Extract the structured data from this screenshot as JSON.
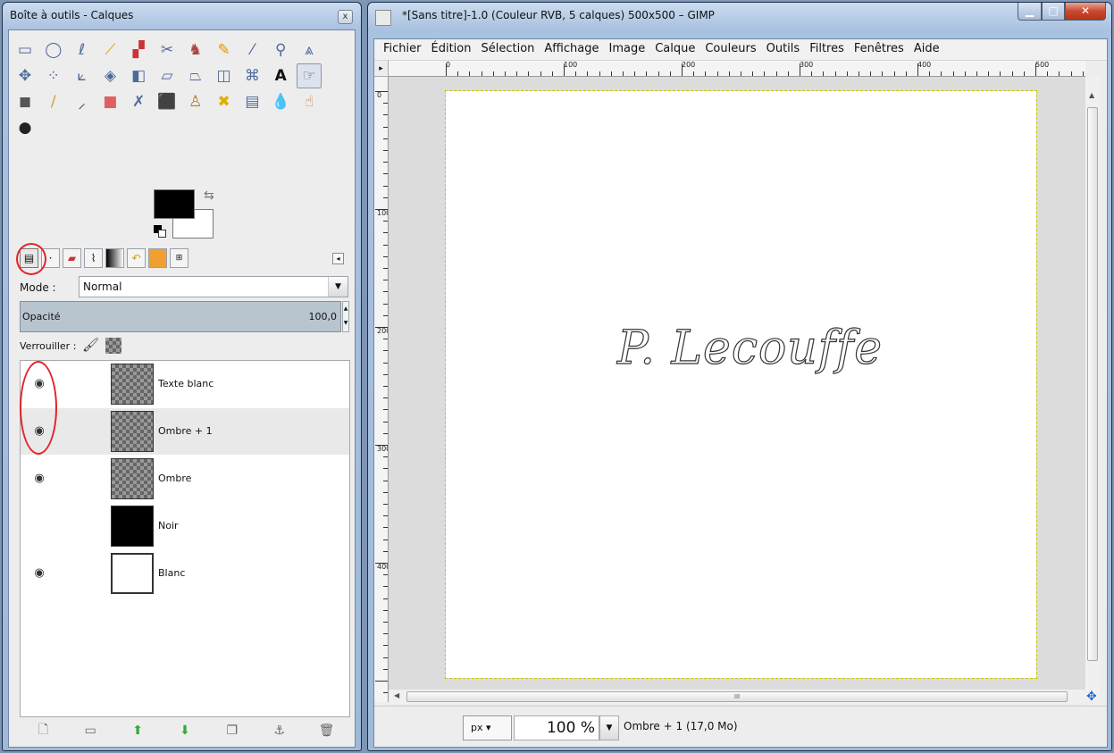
{
  "toolbox": {
    "title": "Boîte à outils - Calques",
    "close": "x",
    "tools_row1": [
      "rect-select",
      "ellipse-select",
      "free-select",
      "fuzzy-select",
      "color-select",
      "scissors-select",
      "foreground-select",
      "paths",
      "color-picker",
      "zoom",
      "measure"
    ],
    "tools_row2": [
      "move",
      "align",
      "crop",
      "rotate",
      "scale",
      "shear",
      "perspective",
      "flip",
      "cage",
      "text",
      "unified-transform"
    ],
    "tools_row3": [
      "blend",
      "pencil",
      "paintbrush",
      "eraser",
      "airbrush",
      "ink",
      "clone",
      "heal",
      "perspective-clone",
      "blur",
      "smudge"
    ],
    "tools_row4": [
      "dodge-burn"
    ],
    "fg_color": "#000000",
    "bg_color": "#ffffff",
    "mode_label": "Mode :",
    "mode_value": "Normal",
    "opacity_label": "Opacité",
    "opacity_value": "100,0",
    "lock_label": "Verrouiller :",
    "layers": [
      {
        "name": "Texte blanc",
        "visible": true,
        "thumb": "checker"
      },
      {
        "name": "Ombre + 1",
        "visible": true,
        "thumb": "checker"
      },
      {
        "name": "Ombre",
        "visible": true,
        "thumb": "checker"
      },
      {
        "name": "Noir",
        "visible": false,
        "thumb": "black"
      },
      {
        "name": "Blanc",
        "visible": true,
        "thumb": "white"
      }
    ],
    "highlight_color": "#e2242a"
  },
  "image_window": {
    "title": "*[Sans titre]-1.0 (Couleur RVB, 5 calques) 500x500 – GIMP",
    "menu": [
      "Fichier",
      "Édition",
      "Sélection",
      "Affichage",
      "Image",
      "Calque",
      "Couleurs",
      "Outils",
      "Filtres",
      "Fenêtres",
      "Aide"
    ],
    "ruler_h": [
      "0",
      "100",
      "200",
      "300",
      "400",
      "500"
    ],
    "ruler_v": [
      "0",
      "100",
      "200",
      "300",
      "400"
    ],
    "canvas_text": "P. Lecouffe",
    "unit": "px",
    "zoom": "100 %",
    "status": "Ombre + 1 (17,0 Mo)"
  }
}
